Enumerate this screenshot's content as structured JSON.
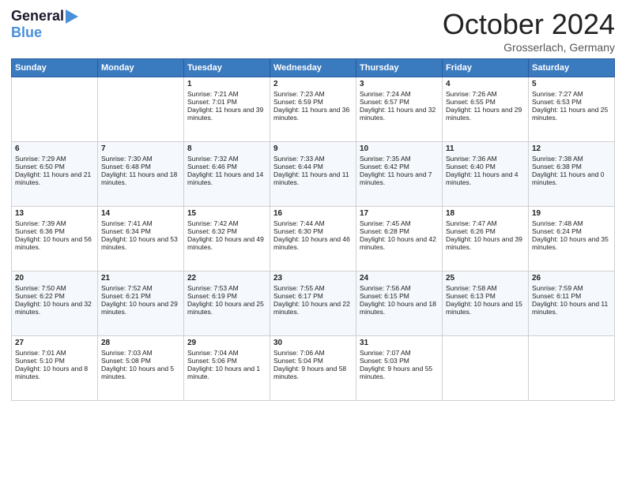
{
  "logo": {
    "general": "General",
    "blue": "Blue"
  },
  "title": "October 2024",
  "location": "Grosserlach, Germany",
  "days_of_week": [
    "Sunday",
    "Monday",
    "Tuesday",
    "Wednesday",
    "Thursday",
    "Friday",
    "Saturday"
  ],
  "weeks": [
    [
      {
        "day": "",
        "sunrise": "",
        "sunset": "",
        "daylight": "",
        "empty": true
      },
      {
        "day": "",
        "sunrise": "",
        "sunset": "",
        "daylight": "",
        "empty": true
      },
      {
        "day": "1",
        "sunrise": "Sunrise: 7:21 AM",
        "sunset": "Sunset: 7:01 PM",
        "daylight": "Daylight: 11 hours and 39 minutes."
      },
      {
        "day": "2",
        "sunrise": "Sunrise: 7:23 AM",
        "sunset": "Sunset: 6:59 PM",
        "daylight": "Daylight: 11 hours and 36 minutes."
      },
      {
        "day": "3",
        "sunrise": "Sunrise: 7:24 AM",
        "sunset": "Sunset: 6:57 PM",
        "daylight": "Daylight: 11 hours and 32 minutes."
      },
      {
        "day": "4",
        "sunrise": "Sunrise: 7:26 AM",
        "sunset": "Sunset: 6:55 PM",
        "daylight": "Daylight: 11 hours and 29 minutes."
      },
      {
        "day": "5",
        "sunrise": "Sunrise: 7:27 AM",
        "sunset": "Sunset: 6:53 PM",
        "daylight": "Daylight: 11 hours and 25 minutes."
      }
    ],
    [
      {
        "day": "6",
        "sunrise": "Sunrise: 7:29 AM",
        "sunset": "Sunset: 6:50 PM",
        "daylight": "Daylight: 11 hours and 21 minutes."
      },
      {
        "day": "7",
        "sunrise": "Sunrise: 7:30 AM",
        "sunset": "Sunset: 6:48 PM",
        "daylight": "Daylight: 11 hours and 18 minutes."
      },
      {
        "day": "8",
        "sunrise": "Sunrise: 7:32 AM",
        "sunset": "Sunset: 6:46 PM",
        "daylight": "Daylight: 11 hours and 14 minutes."
      },
      {
        "day": "9",
        "sunrise": "Sunrise: 7:33 AM",
        "sunset": "Sunset: 6:44 PM",
        "daylight": "Daylight: 11 hours and 11 minutes."
      },
      {
        "day": "10",
        "sunrise": "Sunrise: 7:35 AM",
        "sunset": "Sunset: 6:42 PM",
        "daylight": "Daylight: 11 hours and 7 minutes."
      },
      {
        "day": "11",
        "sunrise": "Sunrise: 7:36 AM",
        "sunset": "Sunset: 6:40 PM",
        "daylight": "Daylight: 11 hours and 4 minutes."
      },
      {
        "day": "12",
        "sunrise": "Sunrise: 7:38 AM",
        "sunset": "Sunset: 6:38 PM",
        "daylight": "Daylight: 11 hours and 0 minutes."
      }
    ],
    [
      {
        "day": "13",
        "sunrise": "Sunrise: 7:39 AM",
        "sunset": "Sunset: 6:36 PM",
        "daylight": "Daylight: 10 hours and 56 minutes."
      },
      {
        "day": "14",
        "sunrise": "Sunrise: 7:41 AM",
        "sunset": "Sunset: 6:34 PM",
        "daylight": "Daylight: 10 hours and 53 minutes."
      },
      {
        "day": "15",
        "sunrise": "Sunrise: 7:42 AM",
        "sunset": "Sunset: 6:32 PM",
        "daylight": "Daylight: 10 hours and 49 minutes."
      },
      {
        "day": "16",
        "sunrise": "Sunrise: 7:44 AM",
        "sunset": "Sunset: 6:30 PM",
        "daylight": "Daylight: 10 hours and 46 minutes."
      },
      {
        "day": "17",
        "sunrise": "Sunrise: 7:45 AM",
        "sunset": "Sunset: 6:28 PM",
        "daylight": "Daylight: 10 hours and 42 minutes."
      },
      {
        "day": "18",
        "sunrise": "Sunrise: 7:47 AM",
        "sunset": "Sunset: 6:26 PM",
        "daylight": "Daylight: 10 hours and 39 minutes."
      },
      {
        "day": "19",
        "sunrise": "Sunrise: 7:48 AM",
        "sunset": "Sunset: 6:24 PM",
        "daylight": "Daylight: 10 hours and 35 minutes."
      }
    ],
    [
      {
        "day": "20",
        "sunrise": "Sunrise: 7:50 AM",
        "sunset": "Sunset: 6:22 PM",
        "daylight": "Daylight: 10 hours and 32 minutes."
      },
      {
        "day": "21",
        "sunrise": "Sunrise: 7:52 AM",
        "sunset": "Sunset: 6:21 PM",
        "daylight": "Daylight: 10 hours and 29 minutes."
      },
      {
        "day": "22",
        "sunrise": "Sunrise: 7:53 AM",
        "sunset": "Sunset: 6:19 PM",
        "daylight": "Daylight: 10 hours and 25 minutes."
      },
      {
        "day": "23",
        "sunrise": "Sunrise: 7:55 AM",
        "sunset": "Sunset: 6:17 PM",
        "daylight": "Daylight: 10 hours and 22 minutes."
      },
      {
        "day": "24",
        "sunrise": "Sunrise: 7:56 AM",
        "sunset": "Sunset: 6:15 PM",
        "daylight": "Daylight: 10 hours and 18 minutes."
      },
      {
        "day": "25",
        "sunrise": "Sunrise: 7:58 AM",
        "sunset": "Sunset: 6:13 PM",
        "daylight": "Daylight: 10 hours and 15 minutes."
      },
      {
        "day": "26",
        "sunrise": "Sunrise: 7:59 AM",
        "sunset": "Sunset: 6:11 PM",
        "daylight": "Daylight: 10 hours and 11 minutes."
      }
    ],
    [
      {
        "day": "27",
        "sunrise": "Sunrise: 7:01 AM",
        "sunset": "Sunset: 5:10 PM",
        "daylight": "Daylight: 10 hours and 8 minutes."
      },
      {
        "day": "28",
        "sunrise": "Sunrise: 7:03 AM",
        "sunset": "Sunset: 5:08 PM",
        "daylight": "Daylight: 10 hours and 5 minutes."
      },
      {
        "day": "29",
        "sunrise": "Sunrise: 7:04 AM",
        "sunset": "Sunset: 5:06 PM",
        "daylight": "Daylight: 10 hours and 1 minute."
      },
      {
        "day": "30",
        "sunrise": "Sunrise: 7:06 AM",
        "sunset": "Sunset: 5:04 PM",
        "daylight": "Daylight: 9 hours and 58 minutes."
      },
      {
        "day": "31",
        "sunrise": "Sunrise: 7:07 AM",
        "sunset": "Sunset: 5:03 PM",
        "daylight": "Daylight: 9 hours and 55 minutes."
      },
      {
        "day": "",
        "sunrise": "",
        "sunset": "",
        "daylight": "",
        "empty": true
      },
      {
        "day": "",
        "sunrise": "",
        "sunset": "",
        "daylight": "",
        "empty": true
      }
    ]
  ]
}
